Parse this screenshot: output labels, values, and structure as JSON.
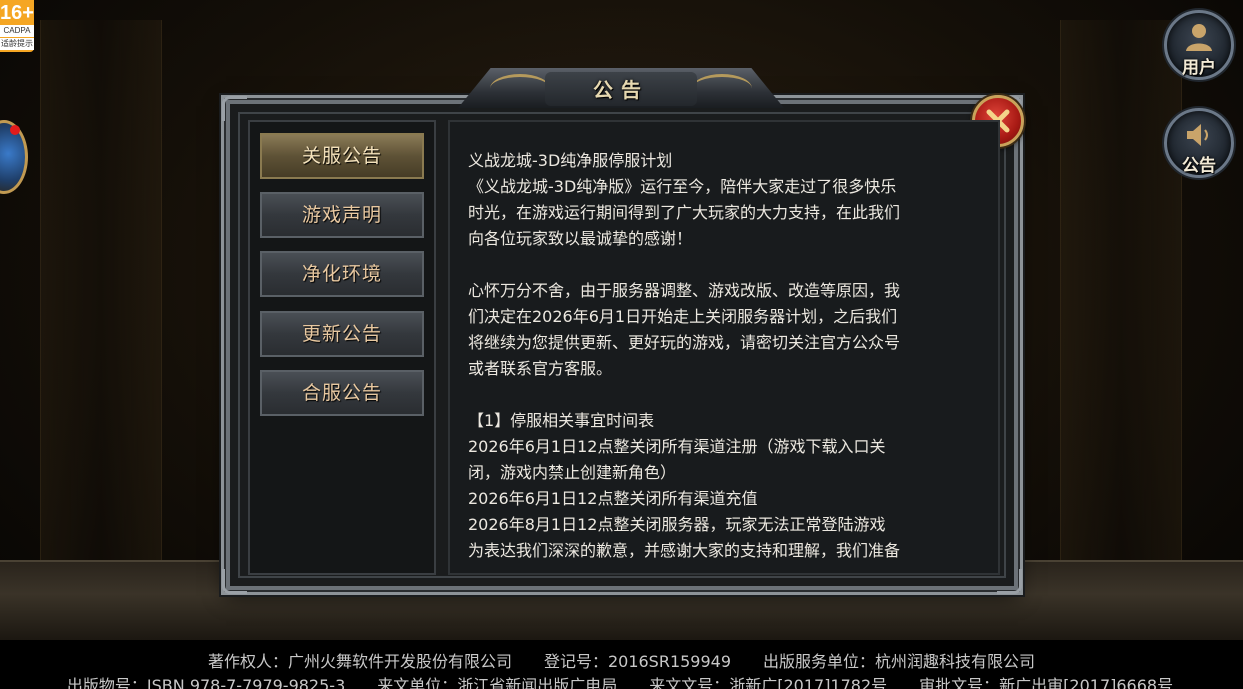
{
  "age_rating": {
    "number": "16+",
    "org": "CADPA",
    "sub": "适龄提示"
  },
  "side_buttons": [
    {
      "label": "用户",
      "icon": "user-icon"
    },
    {
      "label": "公告",
      "icon": "speaker-icon"
    }
  ],
  "dialog": {
    "title": "公告",
    "close_icon": "close-icon",
    "tabs": [
      {
        "label": "关服公告",
        "active": true
      },
      {
        "label": "游戏声明",
        "active": false
      },
      {
        "label": "净化环境",
        "active": false
      },
      {
        "label": "更新公告",
        "active": false
      },
      {
        "label": "合服公告",
        "active": false
      }
    ],
    "content_lines": [
      "义战龙城-3D纯净服停服计划",
      "《义战龙城-3D纯净版》运行至今，陪伴大家走过了很多快乐",
      "时光，在游戏运行期间得到了广大玩家的大力支持，在此我们",
      "向各位玩家致以最诚挚的感谢！",
      "",
      "心怀万分不舍，由于服务器调整、游戏改版、改造等原因，我",
      "们决定在2026年6月1日开始走上关闭服务器计划，之后我们",
      "将继续为您提供更新、更好玩的游戏，请密切关注官方公众号",
      "或者联系官方客服。",
      "",
      "【1】停服相关事宜时间表",
      "2026年6月1日12点整关闭所有渠道注册（游戏下载入口关",
      "闭，游戏内禁止创建新角色）",
      "2026年6月1日12点整关闭所有渠道充值",
      "2026年8月1日12点整关闭服务器，玩家无法正常登陆游戏",
      "为表达我们深深的歉意，并感谢大家的支持和理解，我们准备"
    ]
  },
  "footer": {
    "line1": "著作权人：广州火舞软件开发股份有限公司　　登记号：2016SR159949　　出版服务单位：杭州润趣科技有限公司",
    "line2": "出版物号：ISBN 978-7-7979-9825-3　　来文单位：浙江省新闻出版广电局　　来文文号：浙新广[2017]1782号　　审批文号：新广出审[2017]6668号"
  }
}
